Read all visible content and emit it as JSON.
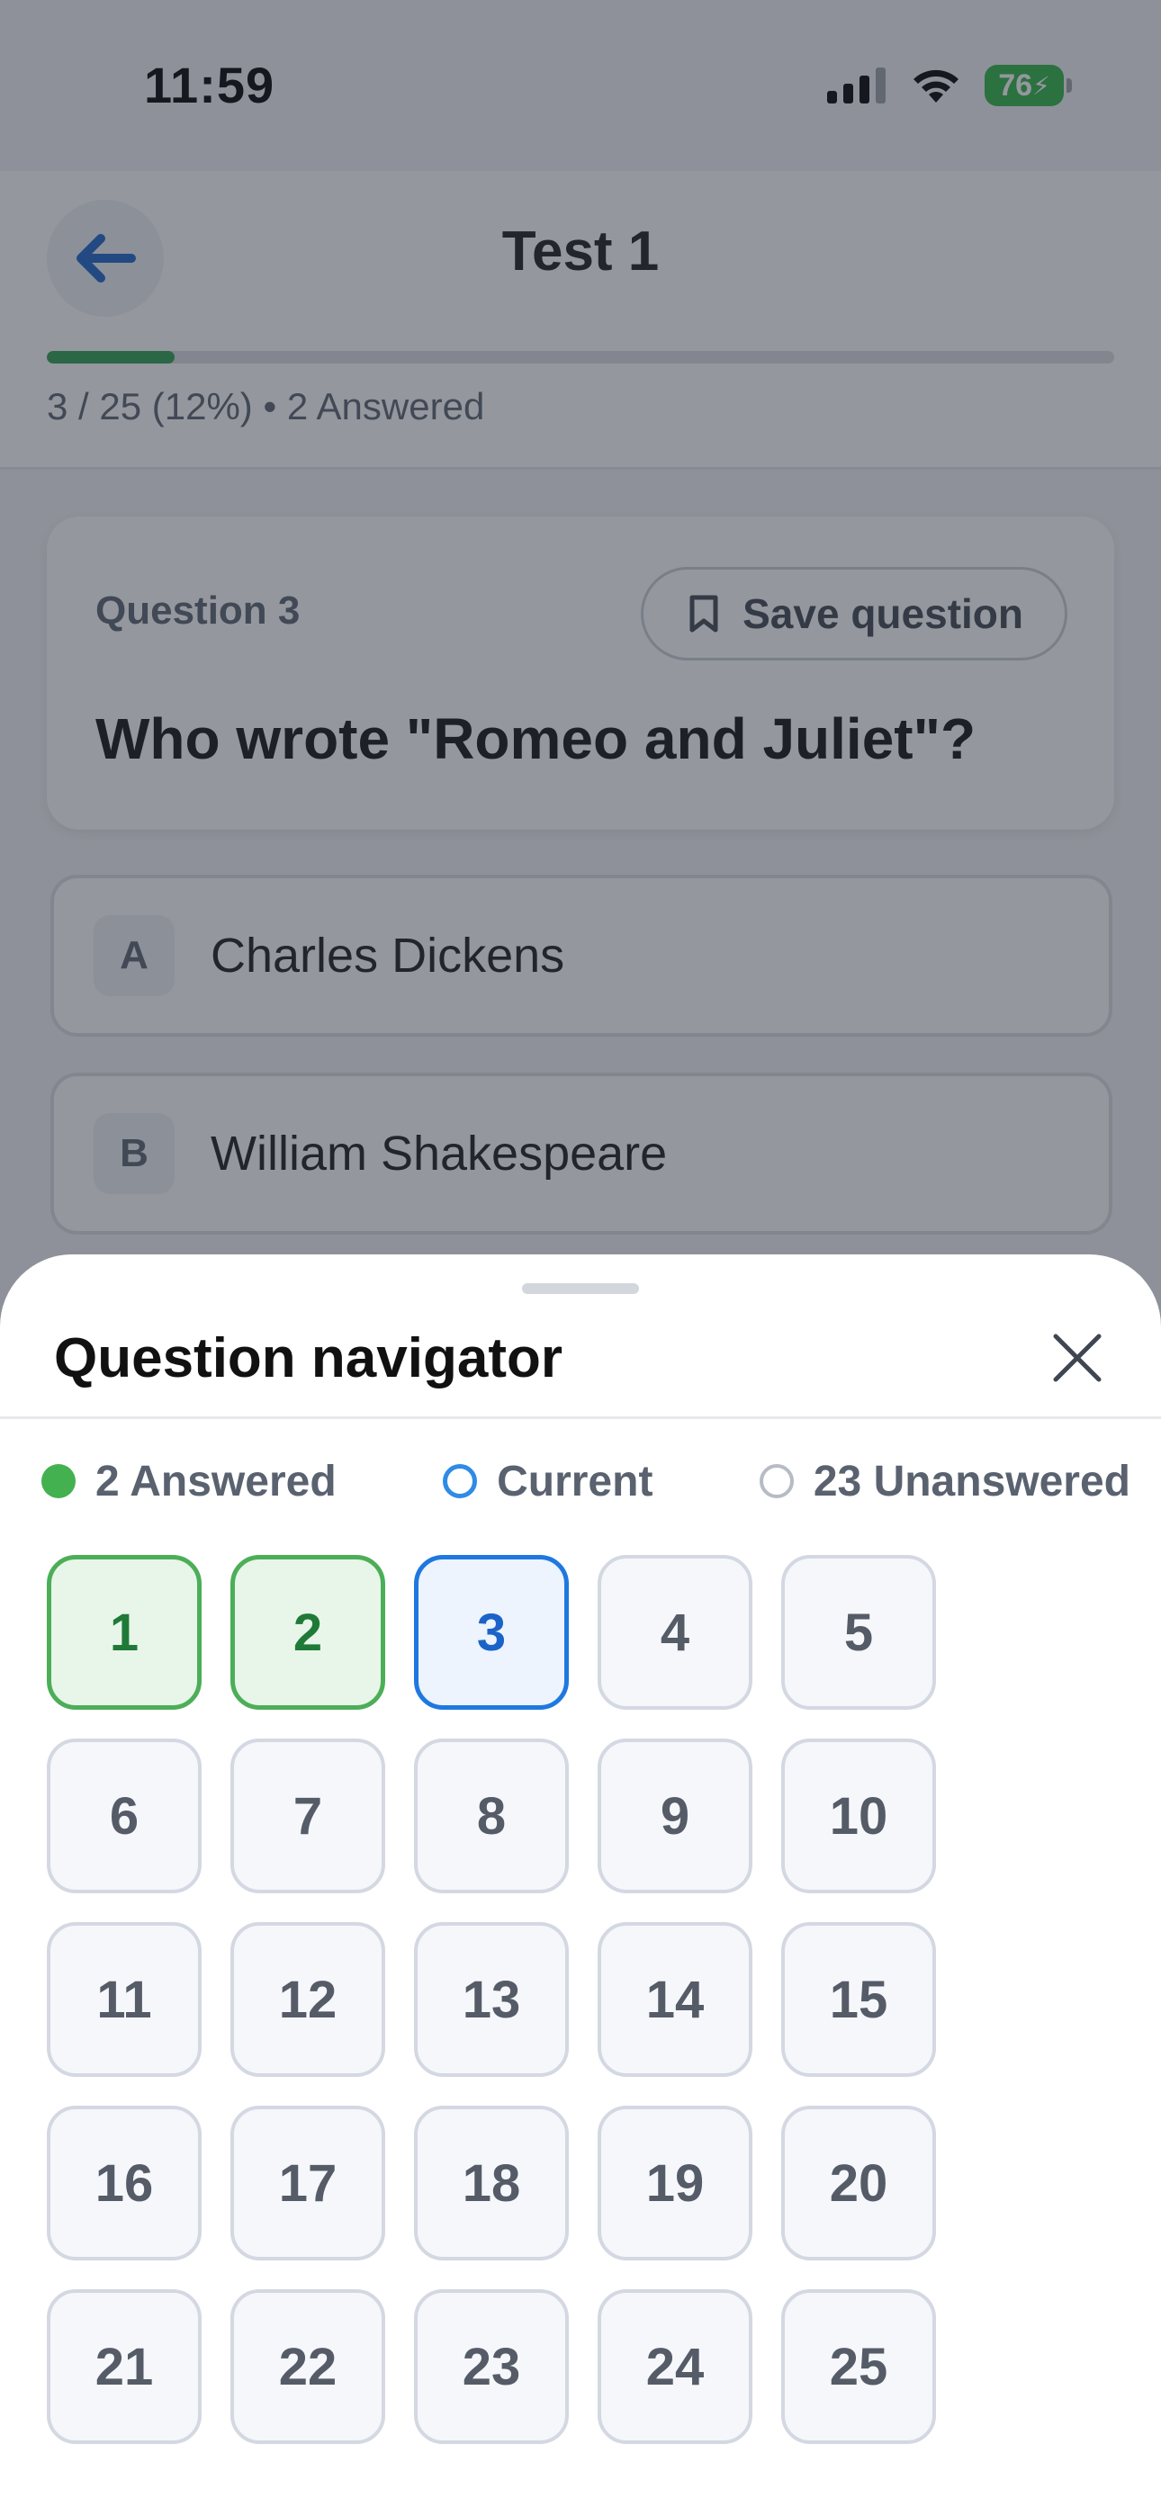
{
  "status_bar": {
    "time": "11:59",
    "battery": "76"
  },
  "header": {
    "title": "Test 1",
    "progress_percent": 12,
    "progress_text": "3 / 25 (12%) • 2 Answered"
  },
  "question": {
    "number_label": "Question 3",
    "save_label": "Save question",
    "text": "Who wrote \"Romeo and Juliet\"?"
  },
  "options": [
    {
      "letter": "A",
      "text": "Charles Dickens"
    },
    {
      "letter": "B",
      "text": "William Shakespeare"
    }
  ],
  "navigator": {
    "title": "Question navigator",
    "legend": {
      "answered": "2 Answered",
      "current": "Current",
      "unanswered": "23 Unanswered"
    },
    "questions": [
      {
        "label": "1",
        "state": "answered"
      },
      {
        "label": "2",
        "state": "answered"
      },
      {
        "label": "3",
        "state": "current"
      },
      {
        "label": "4",
        "state": "unanswered"
      },
      {
        "label": "5",
        "state": "unanswered"
      },
      {
        "label": "6",
        "state": "unanswered"
      },
      {
        "label": "7",
        "state": "unanswered"
      },
      {
        "label": "8",
        "state": "unanswered"
      },
      {
        "label": "9",
        "state": "unanswered"
      },
      {
        "label": "10",
        "state": "unanswered"
      },
      {
        "label": "11",
        "state": "unanswered"
      },
      {
        "label": "12",
        "state": "unanswered"
      },
      {
        "label": "13",
        "state": "unanswered"
      },
      {
        "label": "14",
        "state": "unanswered"
      },
      {
        "label": "15",
        "state": "unanswered"
      },
      {
        "label": "16",
        "state": "unanswered"
      },
      {
        "label": "17",
        "state": "unanswered"
      },
      {
        "label": "18",
        "state": "unanswered"
      },
      {
        "label": "19",
        "state": "unanswered"
      },
      {
        "label": "20",
        "state": "unanswered"
      },
      {
        "label": "21",
        "state": "unanswered"
      },
      {
        "label": "22",
        "state": "unanswered"
      },
      {
        "label": "23",
        "state": "unanswered"
      },
      {
        "label": "24",
        "state": "unanswered"
      },
      {
        "label": "25",
        "state": "unanswered"
      }
    ]
  },
  "colors": {
    "answered": "#4cae57",
    "current": "#1f78e0",
    "progress": "#2e9e4f",
    "back_arrow": "#1a63c9"
  },
  "icons": {
    "back": "arrow-left-icon",
    "save": "bookmark-icon",
    "close": "close-icon"
  }
}
